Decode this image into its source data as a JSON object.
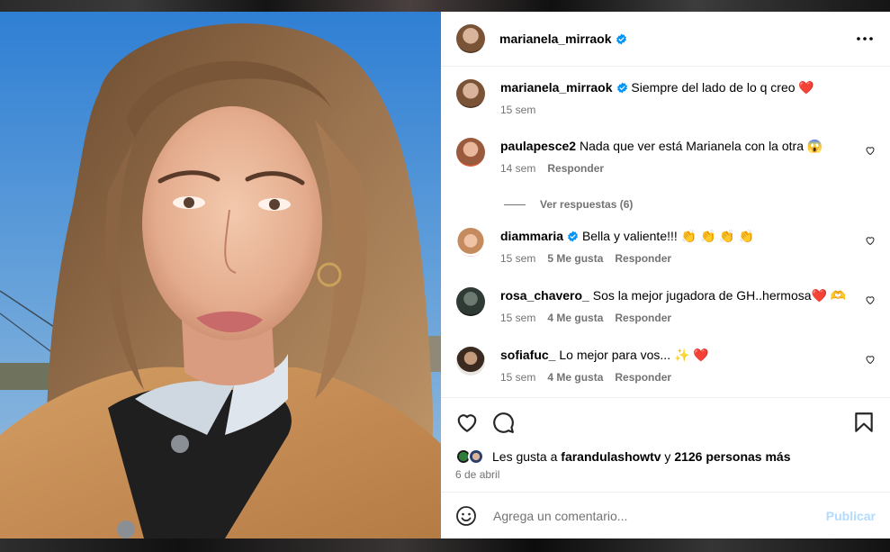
{
  "post": {
    "author": "marianela_mirraok",
    "caption": "Siempre del lado de lo q creo ❤️",
    "caption_time": "15 sem"
  },
  "comments": [
    {
      "user": "paulapesce2",
      "text": "Nada que ver está Marianela con la otra 😱",
      "time": "14 sem",
      "likes": "",
      "reply": "Responder",
      "verified": false
    },
    {
      "user": "diammaria",
      "text": "Bella y valiente!!! 👏 👏 👏 👏",
      "time": "15 sem",
      "likes": "5 Me gusta",
      "reply": "Responder",
      "verified": true
    },
    {
      "user": "rosa_chavero_",
      "text": "Sos la mejor jugadora de GH..hermosa❤️ 🫶",
      "time": "15 sem",
      "likes": "4 Me gusta",
      "reply": "Responder",
      "verified": false
    },
    {
      "user": "sofiafuc_",
      "text": "Lo mejor para vos... ✨ ❤️",
      "time": "15 sem",
      "likes": "4 Me gusta",
      "reply": "Responder",
      "verified": false
    }
  ],
  "view_replies": "Ver respuestas (6)",
  "likes": {
    "prefix": "Les gusta a",
    "user": "farandulashowtv",
    "connector": "y",
    "others": "2126 personas más"
  },
  "date": "6 de abril",
  "add_comment": {
    "placeholder": "Agrega un comentario...",
    "publish_label": "Publicar"
  },
  "colors": {
    "verified": "#0095f6",
    "publish_disabled": "#b3dbff",
    "secondary_text": "#737373"
  }
}
